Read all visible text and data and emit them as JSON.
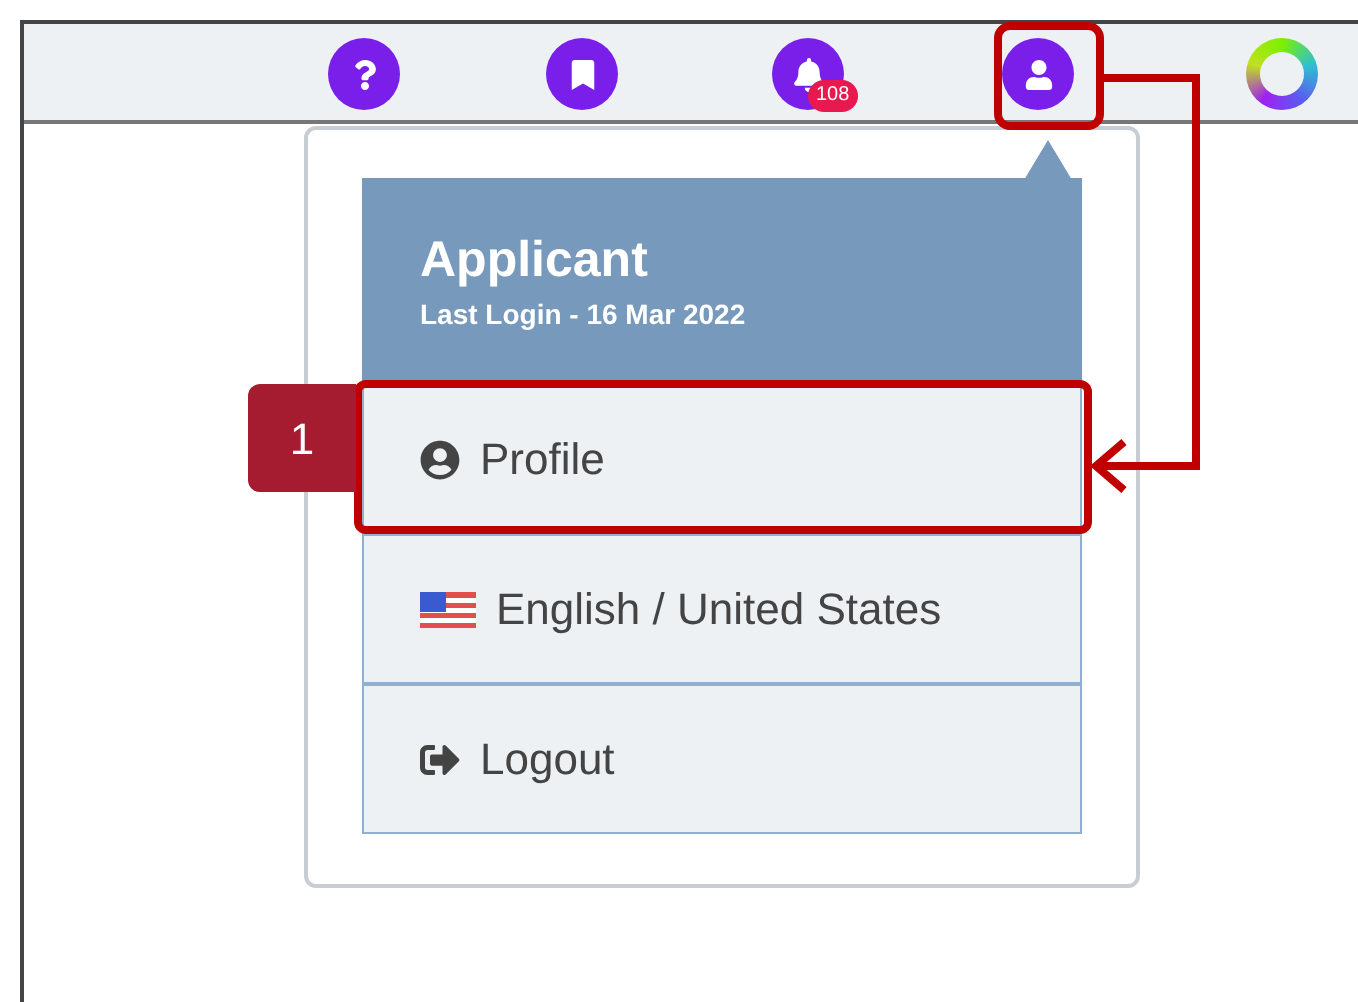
{
  "toolbar": {
    "items": [
      {
        "kind": "help"
      },
      {
        "kind": "bookmark"
      },
      {
        "kind": "notifications",
        "badge": "108"
      },
      {
        "kind": "account"
      },
      {
        "kind": "loading"
      }
    ]
  },
  "user_menu": {
    "name": "Applicant",
    "last_login": "Last Login - 16 Mar 2022",
    "items": [
      {
        "kind": "profile",
        "label": "Profile"
      },
      {
        "kind": "language",
        "label": "English / United States"
      },
      {
        "kind": "logout",
        "label": "Logout"
      }
    ]
  },
  "callout": {
    "step": "1"
  }
}
